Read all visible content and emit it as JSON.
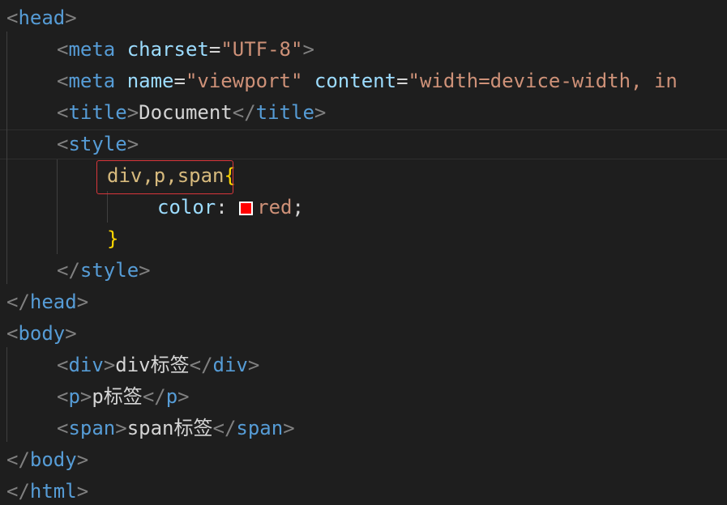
{
  "editor": {
    "theme": "dark",
    "colors": {
      "background": "#1e1e1e",
      "tag": "#569cd6",
      "attribute": "#9cdcfe",
      "string": "#ce9178",
      "selector": "#d7ba7d",
      "brace": "#ffd700",
      "punctuation": "#808080",
      "text": "#d4d4d4",
      "color_swatch": "#ff0000",
      "highlight_box": "#d9363b"
    },
    "lines": [
      {
        "tokens": [
          {
            "t": "punct",
            "v": "<"
          },
          {
            "t": "tag",
            "v": "head"
          },
          {
            "t": "punct",
            "v": ">"
          }
        ]
      },
      {
        "tokens": [
          {
            "t": "punct",
            "v": "<"
          },
          {
            "t": "tag",
            "v": "meta"
          },
          {
            "t": "text",
            "v": " "
          },
          {
            "t": "attr",
            "v": "charset"
          },
          {
            "t": "text",
            "v": "="
          },
          {
            "t": "str",
            "v": "\"UTF-8\""
          },
          {
            "t": "punct",
            "v": ">"
          }
        ]
      },
      {
        "tokens": [
          {
            "t": "punct",
            "v": "<"
          },
          {
            "t": "tag",
            "v": "meta"
          },
          {
            "t": "text",
            "v": " "
          },
          {
            "t": "attr",
            "v": "name"
          },
          {
            "t": "text",
            "v": "="
          },
          {
            "t": "str",
            "v": "\"viewport\""
          },
          {
            "t": "text",
            "v": " "
          },
          {
            "t": "attr",
            "v": "content"
          },
          {
            "t": "text",
            "v": "="
          },
          {
            "t": "str",
            "v": "\"width=device-width, in"
          }
        ]
      },
      {
        "tokens": [
          {
            "t": "punct",
            "v": "<"
          },
          {
            "t": "tag",
            "v": "title"
          },
          {
            "t": "punct",
            "v": ">"
          },
          {
            "t": "text",
            "v": "Document"
          },
          {
            "t": "punct",
            "v": "</"
          },
          {
            "t": "tag",
            "v": "title"
          },
          {
            "t": "punct",
            "v": ">"
          }
        ]
      },
      {
        "tokens": [
          {
            "t": "punct",
            "v": "<"
          },
          {
            "t": "tag",
            "v": "style"
          },
          {
            "t": "punct",
            "v": ">"
          }
        ]
      },
      {
        "tokens": [
          {
            "t": "sel",
            "v": "div,p,span"
          },
          {
            "t": "brace",
            "v": "{"
          }
        ]
      },
      {
        "tokens": [
          {
            "t": "prop",
            "v": "color"
          },
          {
            "t": "text",
            "v": ": "
          },
          {
            "t": "swatch",
            "v": ""
          },
          {
            "t": "str",
            "v": "red"
          },
          {
            "t": "text",
            "v": ";"
          }
        ]
      },
      {
        "tokens": [
          {
            "t": "brace",
            "v": "}"
          }
        ]
      },
      {
        "tokens": [
          {
            "t": "punct",
            "v": "</"
          },
          {
            "t": "tag",
            "v": "style"
          },
          {
            "t": "punct",
            "v": ">"
          }
        ]
      },
      {
        "tokens": [
          {
            "t": "punct",
            "v": "</"
          },
          {
            "t": "tag",
            "v": "head"
          },
          {
            "t": "punct",
            "v": ">"
          }
        ]
      },
      {
        "tokens": [
          {
            "t": "punct",
            "v": "<"
          },
          {
            "t": "tag",
            "v": "body"
          },
          {
            "t": "punct",
            "v": ">"
          }
        ]
      },
      {
        "tokens": [
          {
            "t": "punct",
            "v": "<"
          },
          {
            "t": "tag",
            "v": "div"
          },
          {
            "t": "punct",
            "v": ">"
          },
          {
            "t": "text",
            "v": "div标签"
          },
          {
            "t": "punct",
            "v": "</"
          },
          {
            "t": "tag",
            "v": "div"
          },
          {
            "t": "punct",
            "v": ">"
          }
        ]
      },
      {
        "tokens": [
          {
            "t": "punct",
            "v": "<"
          },
          {
            "t": "tag",
            "v": "p"
          },
          {
            "t": "punct",
            "v": ">"
          },
          {
            "t": "text",
            "v": "p标签"
          },
          {
            "t": "punct",
            "v": "</"
          },
          {
            "t": "tag",
            "v": "p"
          },
          {
            "t": "punct",
            "v": ">"
          }
        ]
      },
      {
        "tokens": [
          {
            "t": "punct",
            "v": "<"
          },
          {
            "t": "tag",
            "v": "span"
          },
          {
            "t": "punct",
            "v": ">"
          },
          {
            "t": "text",
            "v": "span标签"
          },
          {
            "t": "punct",
            "v": "</"
          },
          {
            "t": "tag",
            "v": "span"
          },
          {
            "t": "punct",
            "v": ">"
          }
        ]
      },
      {
        "tokens": [
          {
            "t": "punct",
            "v": "</"
          },
          {
            "t": "tag",
            "v": "body"
          },
          {
            "t": "punct",
            "v": ">"
          }
        ]
      },
      {
        "tokens": [
          {
            "t": "punct",
            "v": "</"
          },
          {
            "t": "tag",
            "v": "html"
          },
          {
            "t": "punct",
            "v": ">"
          }
        ]
      }
    ]
  }
}
